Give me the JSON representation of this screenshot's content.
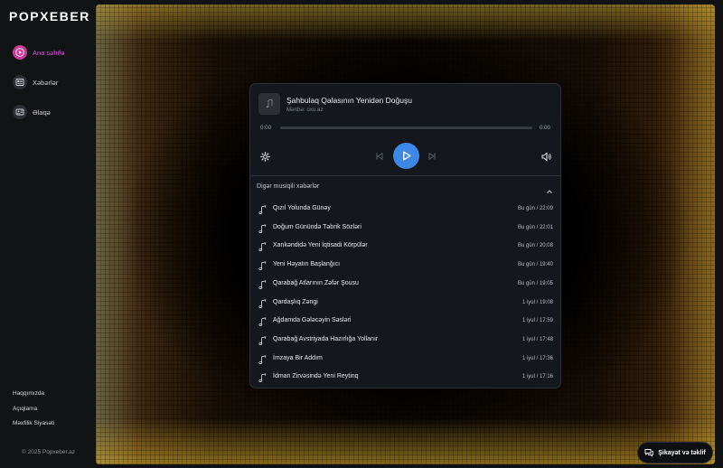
{
  "app": {
    "logo": "POPXEBER"
  },
  "sidebar": {
    "nav": [
      {
        "label": "Ana səhifə",
        "icon": "play-icon",
        "active": true
      },
      {
        "label": "Xəbərlər",
        "icon": "news-icon",
        "active": false
      },
      {
        "label": "Əlaqə",
        "icon": "contact-icon",
        "active": false
      }
    ],
    "footer": [
      "Haqqımızda",
      "Açıqlama",
      "Məxfilik Siyasəti"
    ],
    "copyright": "© 2025 Popxeber.az"
  },
  "player": {
    "title": "Şahbulaq Qalasının Yenidən Doğuşu",
    "source": "Mənbə: oxu.az",
    "current_time": "0:00",
    "duration": "0:00",
    "progress": 0,
    "icons": [
      "settings-icon",
      "previous-icon",
      "play-icon",
      "next-icon",
      "volume-icon"
    ]
  },
  "list": {
    "header": "Digər musiqili xəbərlər",
    "items": [
      {
        "title": "Qızıl Yolunda Günəy",
        "date": "Bu gün / 22:09"
      },
      {
        "title": "Doğum Günündə Təbrik Sözləri",
        "date": "Bu gün / 22:01"
      },
      {
        "title": "Xankəndidə Yeni İqtisadi Körpülər",
        "date": "Bu gün / 20:08"
      },
      {
        "title": "Yeni Həyatın Başlanğıcı",
        "date": "Bu gün / 19:40"
      },
      {
        "title": "Qarabağ Atlarının Zəfər Şousu",
        "date": "Bu gün / 19:05"
      },
      {
        "title": "Qardaşlıq Zəngi",
        "date": "1 iyul / 19:08"
      },
      {
        "title": "Ağdamda Gələcəyin Səsləri",
        "date": "1 iyul / 17:59"
      },
      {
        "title": "Qarabağ Avstriyada Hazırlığa Yollanır",
        "date": "1 iyul / 17:48"
      },
      {
        "title": "İmzaya Bir Addım",
        "date": "1 iyul / 17:36"
      },
      {
        "title": "İdman Zirvəsində Yeni Reytinq",
        "date": "1 iyul / 17:16"
      }
    ]
  },
  "feedback": {
    "label": "Şikayət və təklif"
  },
  "colors": {
    "accent": "#3d87e6",
    "active_nav": "#d45bd8"
  }
}
